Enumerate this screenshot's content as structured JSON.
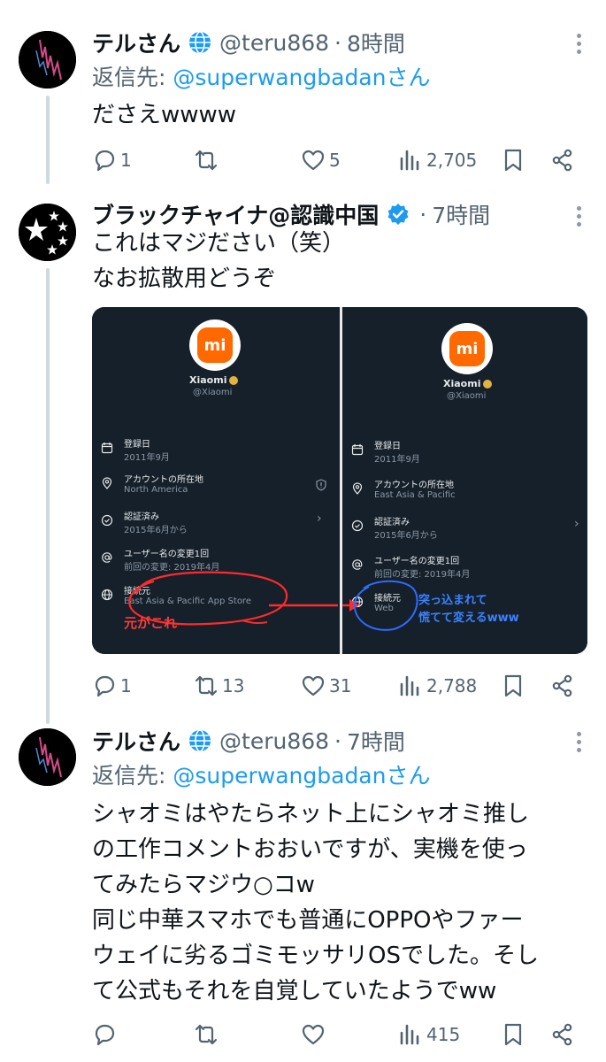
{
  "tweets": [
    {
      "name": "テルさん",
      "handle": "@teru868",
      "time": "8時間",
      "reply_label": "返信先: ",
      "reply_mention": "@superwangbadanさん",
      "lines": [
        "ださえwwww"
      ],
      "replies": "1",
      "retweets": "",
      "likes": "5",
      "views": "2,705"
    },
    {
      "name": "ブラックチャイナ@認識中国",
      "handle": "",
      "time": "7時間",
      "lines": [
        "これはマジださい（笑）",
        "なお拡散用どうぞ"
      ],
      "replies": "1",
      "retweets": "13",
      "likes": "31",
      "views": "2,788"
    },
    {
      "name": "テルさん",
      "handle": "@teru868",
      "time": "7時間",
      "reply_label": "返信先: ",
      "reply_mention": "@superwangbadanさん",
      "lines": [
        "シャオミはやたらネット上にシャオミ推し",
        "の工作コメントおおいですが、実機を使っ",
        "てみたらマジウ○コw",
        "同じ中華スマホでも普通にOPPOやファー",
        "ウェイに劣るゴミモッサリOSでした。そし",
        "て公式もそれを自覚していたようでww"
      ],
      "replies": "",
      "retweets": "",
      "likes": "",
      "views": "415"
    }
  ],
  "media": {
    "left": {
      "logo": "mi",
      "name": "Xiaomi",
      "handle": "@Xiaomi",
      "rows": [
        {
          "icon": "calendar-icon",
          "label": "登録日",
          "value": "2011年9月"
        },
        {
          "icon": "location-icon",
          "label": "アカウントの所在地",
          "value": "North America"
        },
        {
          "icon": "verified-check-icon",
          "label": "認証済み",
          "value": "2015年6月から"
        },
        {
          "icon": "at-icon",
          "label": "ユーザー名の変更1回",
          "value": "前回の変更: 2019年4月"
        },
        {
          "icon": "globe-icon",
          "label": "接続元",
          "value": "East Asia & Pacific App Store"
        }
      ],
      "annotation": "元がこれ"
    },
    "right": {
      "logo": "mi",
      "name": "Xiaomi",
      "handle": "@Xiaomi",
      "rows": [
        {
          "icon": "calendar-icon",
          "label": "登録日",
          "value": "2011年9月"
        },
        {
          "icon": "location-icon",
          "label": "アカウントの所在地",
          "value": "East Asia & Pacific"
        },
        {
          "icon": "verified-check-icon",
          "label": "認証済み",
          "value": "2015年6月から"
        },
        {
          "icon": "at-icon",
          "label": "ユーザー名の変更1回",
          "value": "前回の変更: 2019年4月"
        },
        {
          "icon": "globe-icon",
          "label": "接続元",
          "value": "Web"
        }
      ],
      "annotation_line1": "突っ込まれて",
      "annotation_line2": "慌てて変えるwww"
    }
  },
  "colors": {
    "link": "#1d9bf0",
    "muted": "#536471",
    "thread_line": "#cfd9de",
    "media_bg": "#15202b",
    "annotation_red": "#ff3b3b",
    "annotation_blue": "#3b82ff"
  }
}
